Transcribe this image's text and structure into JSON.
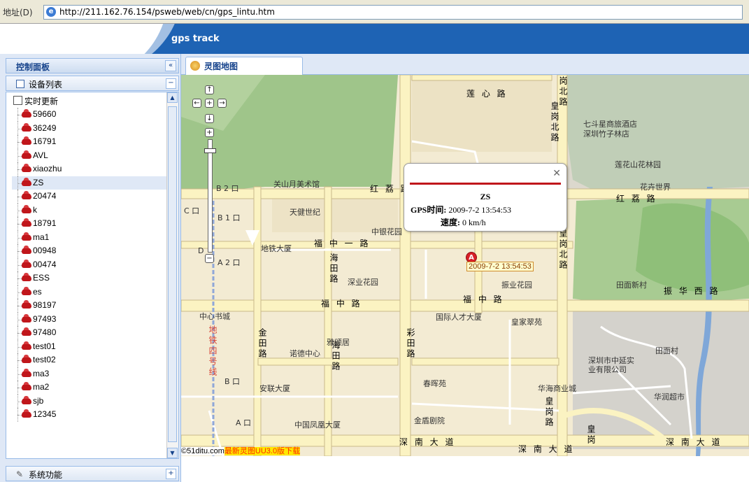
{
  "browser": {
    "address_label": "地址(D)",
    "url": "http://211.162.76.154/psweb/web/cn/gps_lintu.htm"
  },
  "banner": {
    "title": "gps track"
  },
  "sidebar": {
    "panel_title": "控制面板",
    "collapse_label": "«",
    "device_list_title": "设备列表",
    "realtime_label": "实时更新",
    "devices": [
      "59660",
      "36249",
      "16791",
      "AVL",
      "xiaozhu",
      "ZS",
      "20474",
      "k",
      "18791",
      "ma1",
      "00948",
      "00474",
      "ESS",
      "es",
      "98197",
      "97493",
      "97480",
      "test01",
      "test02",
      "ma3",
      "ma2",
      "sjb",
      "12345"
    ],
    "selected_device": "ZS",
    "system_label": "系统功能"
  },
  "map_tab": {
    "label": "灵图地图"
  },
  "map": {
    "roads": {
      "lianxin": "莲 心 路",
      "hongli_w": "红 荔 路",
      "hongli_e": "红 荔 路",
      "fuzhongyi": "福 中 一 路",
      "fuzhong_w": "福 中 路",
      "fuzhong_e": "福 中 路",
      "shennan_1": "深 南 大 道",
      "shennan_2": "深 南 大 道",
      "shennan_3": "深 南 大 道",
      "zhenhuaxi": "振 华 西 路",
      "huanggang_n": "皇岗北路",
      "huanggang_mid": "皇岗北路",
      "huanggang_s": "皇岗路",
      "huanggang_far": "皇岗",
      "haitian": "海田路",
      "haitian2": "海田路",
      "jintian": "金田路",
      "caitian": "彩田路",
      "metro": "地铁四号线",
      "lianxin_r": "岗北路"
    },
    "places": {
      "qidou": "七斗星商旅酒店",
      "zhuzilin": "深圳竹子林店",
      "lianhuashan": "莲花山花林园",
      "huahui": "花卉世界",
      "guanshan": "关山月美术馆",
      "tianjian": "天健世纪",
      "zhongyin": "中银花园",
      "ditie": "地铁大厦",
      "shenye": "深业花园",
      "zhenye": "振业花园",
      "tianmian": "田面新村",
      "zhongxin": "中心书城",
      "guoji": "国际人才大厦",
      "huangjia": "皇家翠苑",
      "yasongju": "雅颂居",
      "nuode": "诺德中心",
      "zhongyan": "深圳市中延实",
      "zhongyan2": "业有限公司",
      "tianmiancun": "田面村",
      "anlian": "安联大厦",
      "chunhui": "春晖苑",
      "huahai": "华海商业城",
      "huarun": "华润超市",
      "fenghuang": "中国凤凰大厦",
      "jindun": "金盾剧院",
      "b2": "B 2 口",
      "b1": "B 1 口",
      "a2": "A 2 口",
      "c": "C 口",
      "d": "D",
      "bkou": "B 口",
      "akou": "A 口"
    },
    "popup": {
      "name": "ZS",
      "time_label": "GPS时间:",
      "time_value": "2009-7-2 13:54:53",
      "speed_label": "速度:",
      "speed_value": "0 km/h"
    },
    "marker": {
      "letter": "A",
      "label": "2009-7-2 13:54:53"
    },
    "credit": {
      "left": "©51ditu.com",
      "right": "最新灵图UU3.0版下载"
    }
  },
  "colors": {
    "banner": "#1e63b4",
    "panel": "#dfe8f6",
    "accent": "#c0161b"
  }
}
